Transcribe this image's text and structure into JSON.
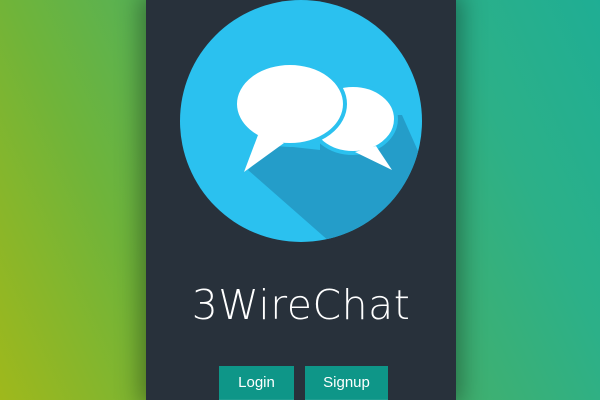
{
  "app": {
    "name": "3WireChat",
    "logo_icon": "chat-bubbles-icon"
  },
  "buttons": {
    "login_label": "Login",
    "signup_label": "Signup"
  },
  "colors": {
    "panel_bg": "#28313b",
    "logo_circle": "#2bc1ef",
    "logo_shadow": "#2399c4",
    "button_bg": "#0e9688",
    "background_gradient": [
      "#9fb81c",
      "#1fae94"
    ]
  }
}
